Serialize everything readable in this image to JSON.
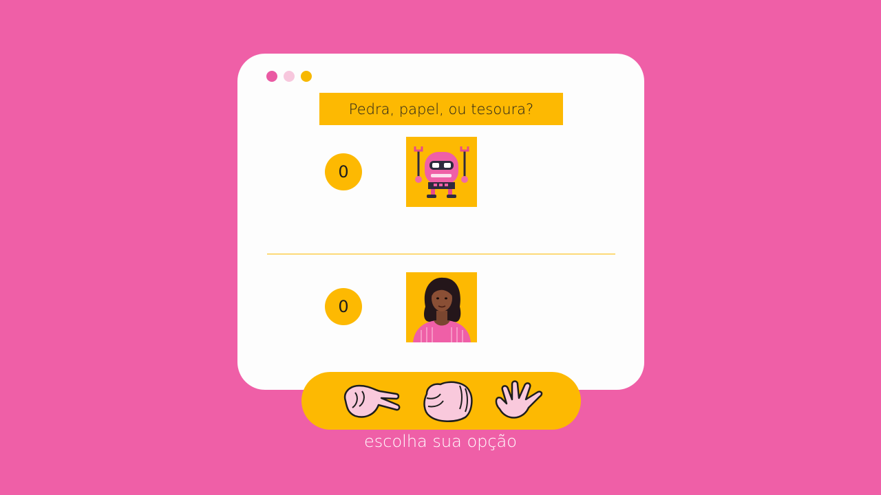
{
  "window": {
    "dots": [
      "#ea5aa3",
      "#f7c7dd",
      "#f7b800"
    ]
  },
  "title": "Pedra, papel, ou tesoura?",
  "computer": {
    "score": "0",
    "avatar": "robot-avatar"
  },
  "player": {
    "score": "0",
    "avatar": "woman-avatar"
  },
  "choices": [
    {
      "icon": "scissors-hand-icon"
    },
    {
      "icon": "rock-fist-icon"
    },
    {
      "icon": "paper-hand-icon"
    }
  ],
  "caption": "escolha sua opção",
  "colors": {
    "background": "#ef5fa7",
    "accent": "#fdb902",
    "window": "#fdfdfd"
  }
}
